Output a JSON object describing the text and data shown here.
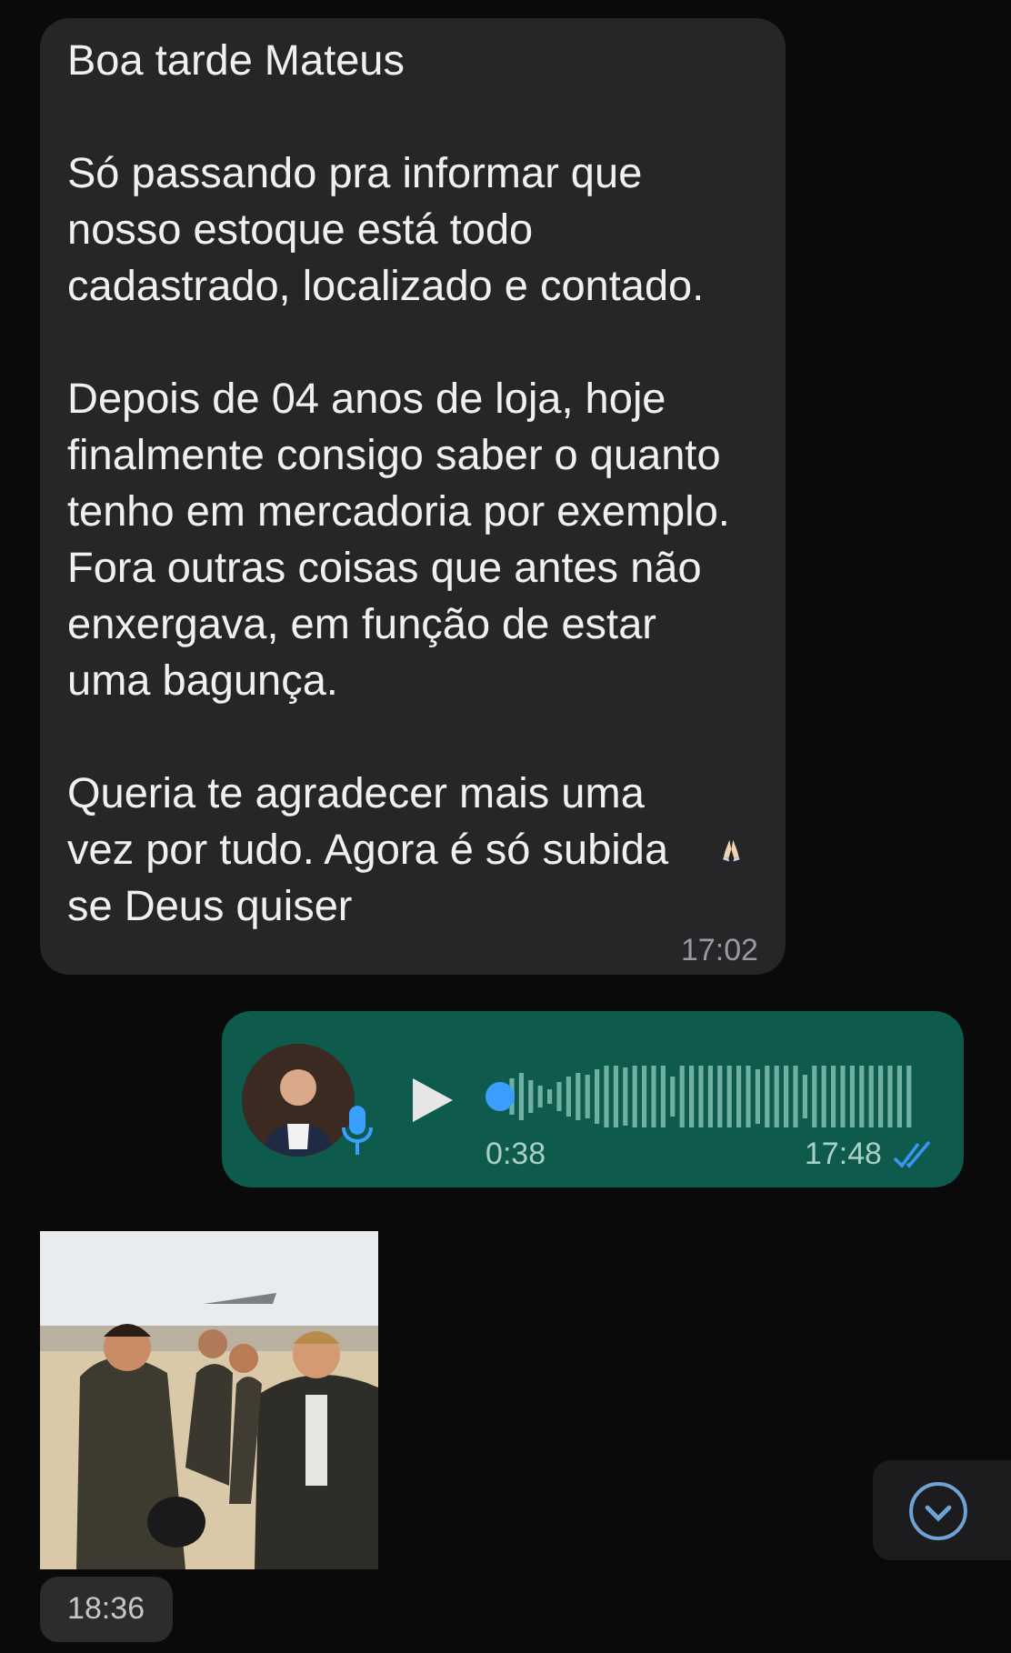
{
  "messages": [
    {
      "kind": "text",
      "sent": false,
      "paragraphs": [
        "Boa tarde Mateus",
        "Só passando pra informar que nosso estoque está todo cadastrado, localizado e contado.",
        "Depois de 04 anos de loja, hoje finalmente consigo saber o quanto tenho em mercadoria por exemplo. Fora outras coisas que antes não enxergava, em função de estar uma bagunça.",
        "Queria te agradecer mais uma vez por tudo. Agora é só subida se Deus quiser"
      ],
      "time": "17:02"
    },
    {
      "kind": "audio",
      "sent": true,
      "duration": "0:38",
      "time": "17:48",
      "read": true
    },
    {
      "sent": false,
      "time": "18:36"
    }
  ]
}
